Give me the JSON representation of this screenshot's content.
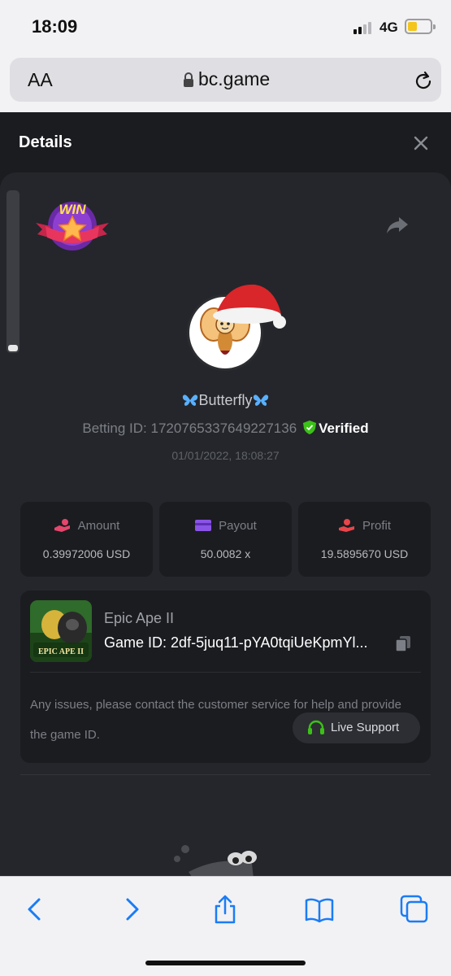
{
  "status_bar": {
    "time": "18:09",
    "network": "4G"
  },
  "browser": {
    "text_size_label": "AA",
    "url": "bc.game"
  },
  "details": {
    "title": "Details",
    "win_badge": "WIN",
    "username": "Butterfly",
    "betting_id_label": "Betting ID:",
    "betting_id": "1720765337649227136",
    "verified_label": "Verified",
    "date": "01/01/2022, 18:08:27",
    "stats": [
      {
        "label": "Amount",
        "value": "0.39972006 USD",
        "icon": "coins-hand-icon",
        "icon_color": "#e5466c"
      },
      {
        "label": "Payout",
        "value": "50.0082 x",
        "icon": "wallet-icon",
        "icon_color": "#8a55e6"
      },
      {
        "label": "Profit",
        "value": "19.5895670 USD",
        "icon": "money-hand-icon",
        "icon_color": "#e8454a"
      }
    ],
    "game": {
      "name": "Epic Ape II",
      "id_label": "Game ID:",
      "id": "2df-5juq11-pYA0tqiUeKpmYl...",
      "thumb_title": "EPIC APE II"
    },
    "help_text": "Any issues, please contact the customer service for help and provide the game ID.",
    "live_support_label": "Live Support"
  },
  "colors": {
    "accent_green": "#3bc117",
    "background": "#24262b",
    "card": "#1b1c20",
    "toolbar_blue": "#1a7cf5"
  },
  "toolbar": {
    "items": [
      "back-icon",
      "forward-icon",
      "share-icon",
      "bookmarks-icon",
      "tabs-icon"
    ]
  }
}
